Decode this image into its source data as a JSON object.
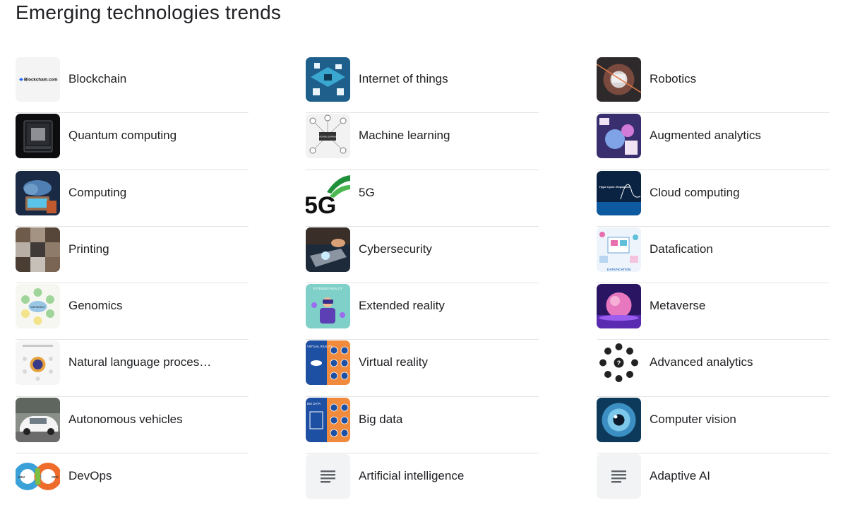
{
  "page": {
    "title": "Emerging technologies trends"
  },
  "columns": [
    {
      "items": [
        {
          "label": "Blockchain",
          "icon": "blockchain-logo-thumbnail",
          "thumb_text": "Blockchain.com"
        },
        {
          "label": "Quantum computing",
          "icon": "quantum-computer-thumbnail"
        },
        {
          "label": "Computing",
          "icon": "cloud-computing-thumbnail"
        },
        {
          "label": "Printing",
          "icon": "printing-collage-thumbnail"
        },
        {
          "label": "Genomics",
          "icon": "genomics-diagram-thumbnail",
          "thumb_text": "Genomics"
        },
        {
          "label": "Natural language proces…",
          "icon": "nlp-diagram-thumbnail"
        },
        {
          "label": "Autonomous vehicles",
          "icon": "self-driving-car-thumbnail"
        },
        {
          "label": "DevOps",
          "icon": "devops-loop-thumbnail",
          "thumb_text_left": "DEV",
          "thumb_text_right": "OPS"
        }
      ]
    },
    {
      "items": [
        {
          "label": "Internet of things",
          "icon": "iot-isometric-thumbnail"
        },
        {
          "label": "Machine learning",
          "icon": "machine-learning-network-thumbnail",
          "thumb_text": "MACHINE LEARNING"
        },
        {
          "label": "5G",
          "icon": "5g-logo-thumbnail",
          "thumb_text": "5G"
        },
        {
          "label": "Cybersecurity",
          "icon": "cybersecurity-laptop-thumbnail"
        },
        {
          "label": "Extended reality",
          "icon": "extended-reality-thumbnail",
          "thumb_text": "EXTENDED REALITY"
        },
        {
          "label": "Virtual reality",
          "icon": "virtual-reality-infographic-thumbnail",
          "thumb_text": "VIRTUAL REALITY"
        },
        {
          "label": "Big data",
          "icon": "big-data-infographic-thumbnail",
          "thumb_text": "BIG DATA"
        },
        {
          "label": "Artificial intelligence",
          "icon": "document-lines-icon"
        }
      ]
    },
    {
      "items": [
        {
          "label": "Robotics",
          "icon": "robotics-thumbnail"
        },
        {
          "label": "Augmented analytics",
          "icon": "augmented-analytics-thumbnail"
        },
        {
          "label": "Cloud computing",
          "icon": "hype-cycle-thumbnail",
          "thumb_text": "Hype Cycle: Explained"
        },
        {
          "label": "Datafication",
          "icon": "datafication-thumbnail",
          "thumb_text": "DATAFICATION"
        },
        {
          "label": "Metaverse",
          "icon": "metaverse-planet-thumbnail"
        },
        {
          "label": "Advanced analytics",
          "icon": "analytics-icons-circle-thumbnail"
        },
        {
          "label": "Computer vision",
          "icon": "eye-closeup-thumbnail"
        },
        {
          "label": "Adaptive AI",
          "icon": "document-lines-icon"
        }
      ]
    }
  ]
}
